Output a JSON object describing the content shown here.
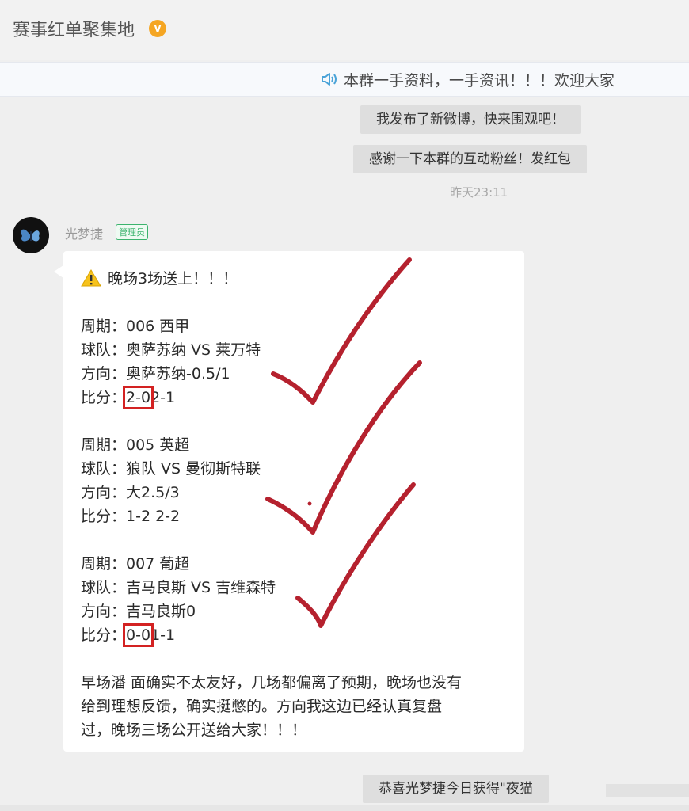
{
  "header": {
    "group_title": "赛事红单聚集地",
    "verified_badge": "V"
  },
  "notice": {
    "icon": "speaker-icon",
    "text": "本群一手资料，一手资讯！！！欢迎大家"
  },
  "system_messages": [
    "我发布了新微博，快来围观吧！",
    "感谢一下本群的互动粉丝！发红包"
  ],
  "timestamp": "昨天23:11",
  "message": {
    "sender": "光梦捷",
    "role_tag": "管理员",
    "headline": "晚场3场送上！！！",
    "matches": [
      {
        "period": "周期：006  西甲",
        "team": "球队：奥萨苏纳 VS 莱万特",
        "direction": "方向：奥萨苏纳-0.5/1",
        "score_label": "比分：",
        "score_boxed": "2-0",
        "score_rest": "2-1"
      },
      {
        "period": "周期：005  英超",
        "team": "球队：狼队 VS 曼彻斯特联",
        "direction": "方向：大2.5/3",
        "score_label": "比分：",
        "score_boxed": "",
        "score_rest": "1-2 2-2"
      },
      {
        "period": "周期：007 葡超",
        "team": "球队：吉马良斯 VS 吉维森特",
        "direction": "方向：吉马良斯0",
        "score_label": "比分：",
        "score_boxed": "0-0",
        "score_rest": "1-1"
      }
    ],
    "footer_lines": [
      "早场潘 面确实不太友好，几场都偏离了预期，晚场也没有",
      "给到理想反馈，确实挺憋的。方向我这边已经认真复盘",
      "过，晚场三场公开送给大家！！！"
    ]
  },
  "bottom_system_message": "恭喜光梦捷今日获得\"夜猫",
  "colors": {
    "check_mark": "#b5212e",
    "highlight_box": "#d32222",
    "admin_green": "#3bb36d"
  }
}
